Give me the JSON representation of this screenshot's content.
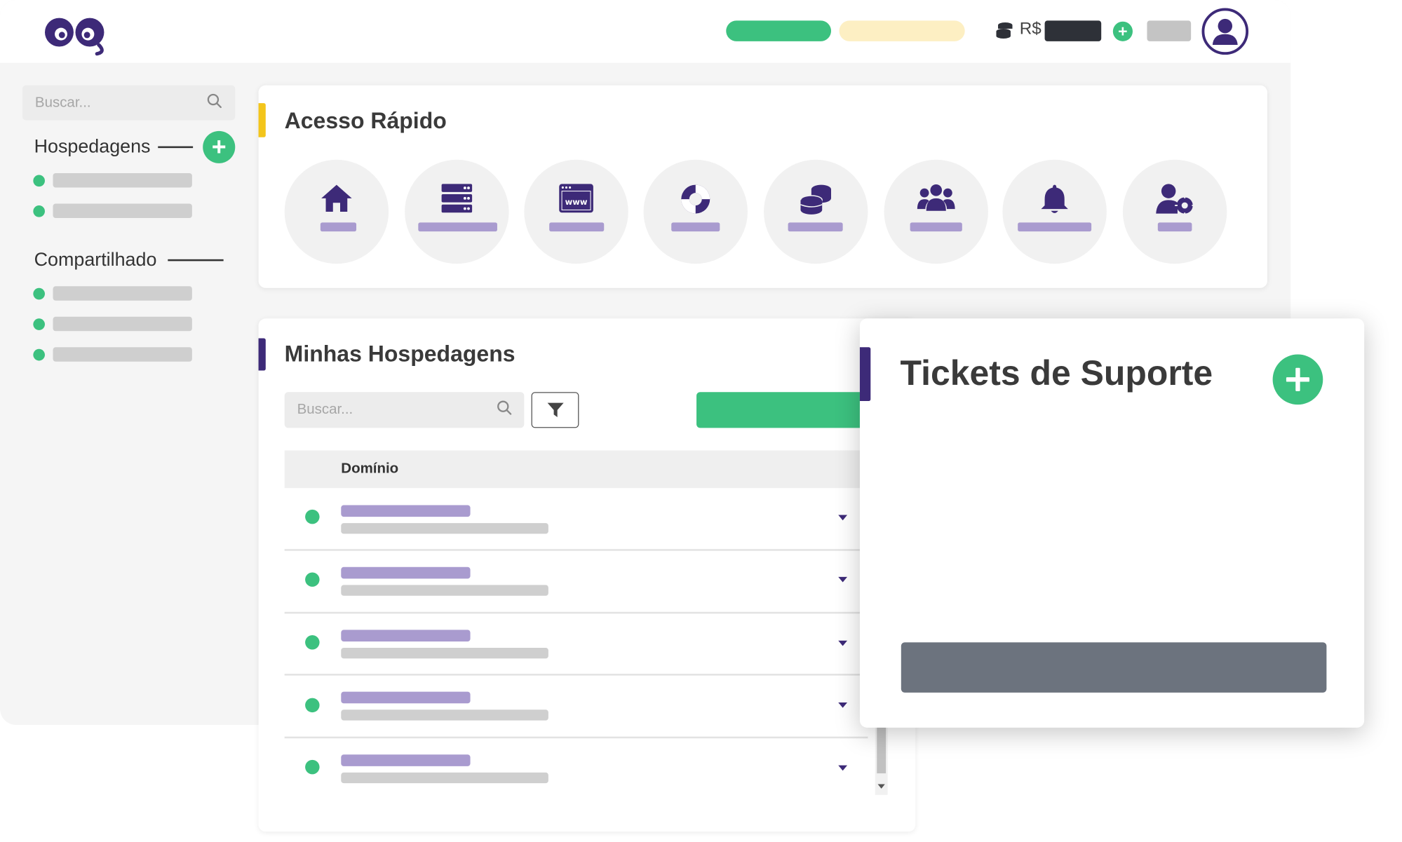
{
  "colors": {
    "brand_purple": "#3d2a78",
    "accent_green": "#3cc17f",
    "accent_yellow": "#f3c51b",
    "label_lilac": "#a99bcf",
    "placeholder_grey": "#cfcfcf"
  },
  "header": {
    "logo_icon": "owl-eyes-logo",
    "status_pill_green_icon": "status-pill",
    "status_pill_yellow_icon": "status-pill",
    "currency_symbol": "R$",
    "coins_icon": "coins-icon",
    "add_icon": "plus-icon",
    "avatar_icon": "user-icon"
  },
  "sidebar": {
    "search_placeholder": "Buscar...",
    "section_hospedagens": "Hospedagens",
    "section_compartilhado": "Compartilhado",
    "add_icon": "plus-icon"
  },
  "quick_access": {
    "title": "Acesso Rápido",
    "items": [
      {
        "icon": "home-icon"
      },
      {
        "icon": "server-icon"
      },
      {
        "icon": "browser-www-icon"
      },
      {
        "icon": "lifebuoy-icon"
      },
      {
        "icon": "coins-stack-icon"
      },
      {
        "icon": "users-group-icon"
      },
      {
        "icon": "bell-icon"
      },
      {
        "icon": "user-settings-icon"
      }
    ]
  },
  "hostings": {
    "title": "Minhas Hospedagens",
    "search_placeholder": "Buscar...",
    "filter_icon": "filter-icon",
    "column_domain": "Domínio",
    "row_count": 5
  },
  "tickets": {
    "title": "Tickets de Suporte",
    "add_icon": "plus-icon"
  }
}
